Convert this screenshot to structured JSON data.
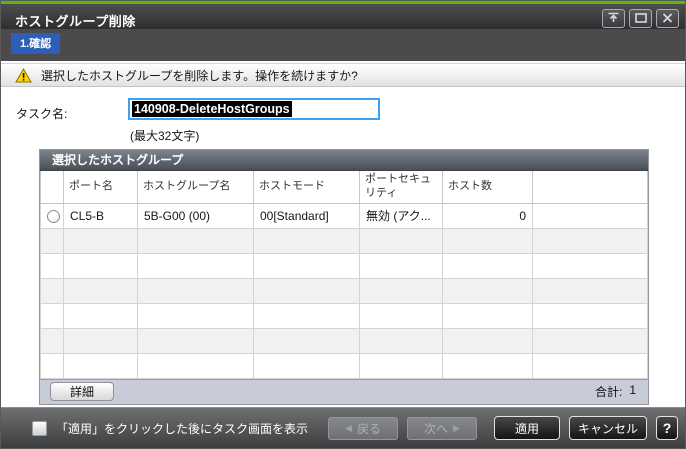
{
  "window": {
    "title": "ホストグループ削除",
    "controls": {
      "collapse": "collapse",
      "maximize": "maximize",
      "close": "close"
    }
  },
  "steps": {
    "current": "1.確認"
  },
  "warning": {
    "message": "選択したホストグループを削除します。操作を続けますか?"
  },
  "task": {
    "label": "タスク名:",
    "value": "140908-DeleteHostGroups",
    "hint": "(最大32文字)"
  },
  "table": {
    "title": "選択したホストグループ",
    "columns": [
      "ポート名",
      "ホストグループ名",
      "ホストモード",
      "ポートセキュリティ",
      "ホスト数"
    ],
    "rows": [
      {
        "port": "CL5-B",
        "host_group": "5B-G00 (00)",
        "host_mode": "00[Standard]",
        "port_security": "無効 (アク...",
        "host_count": "0",
        "selected": false
      }
    ],
    "empty_row_count": 6,
    "detail_button": "詳細",
    "total_label": "合計:",
    "total_value": "1"
  },
  "footer": {
    "checkbox_label": "「適用」をクリックした後にタスク画面を表示",
    "checkbox_checked": false,
    "back_arrow": "◀",
    "back_button": "戻る",
    "next_button": "次へ",
    "next_arrow": "▶",
    "apply_button": "適用",
    "cancel_button": "キャンセル",
    "help_button": "?"
  },
  "colors": {
    "accent_green": "#5db80a",
    "tab_blue": "#2d5fb8",
    "focus_border": "#3f9ff0",
    "titlebar_bg": "#3a3a3c",
    "table_footer_bg": "#c7ccd8",
    "warning_yellow": "#ffd400",
    "selection_bg": "#000000"
  }
}
